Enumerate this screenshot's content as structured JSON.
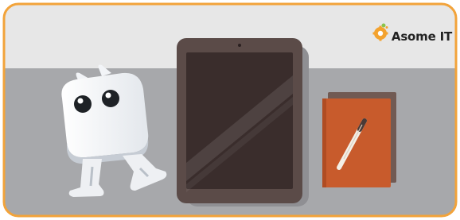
{
  "brand": {
    "name": "Asome IT",
    "logo_icon": "gear-bulb-icon"
  },
  "colors": {
    "border_orange": "#f2a33a",
    "wall": "#e6e6e6",
    "desk": "#a6a7aa",
    "tablet_frame": "#5a4b48",
    "tablet_screen": "#3a2e2d",
    "notebook": "#c45a2d",
    "robot_body": "#f4f6f8"
  },
  "scene": {
    "objects": [
      "robot-character",
      "tablet-device",
      "notebook",
      "pen"
    ]
  }
}
